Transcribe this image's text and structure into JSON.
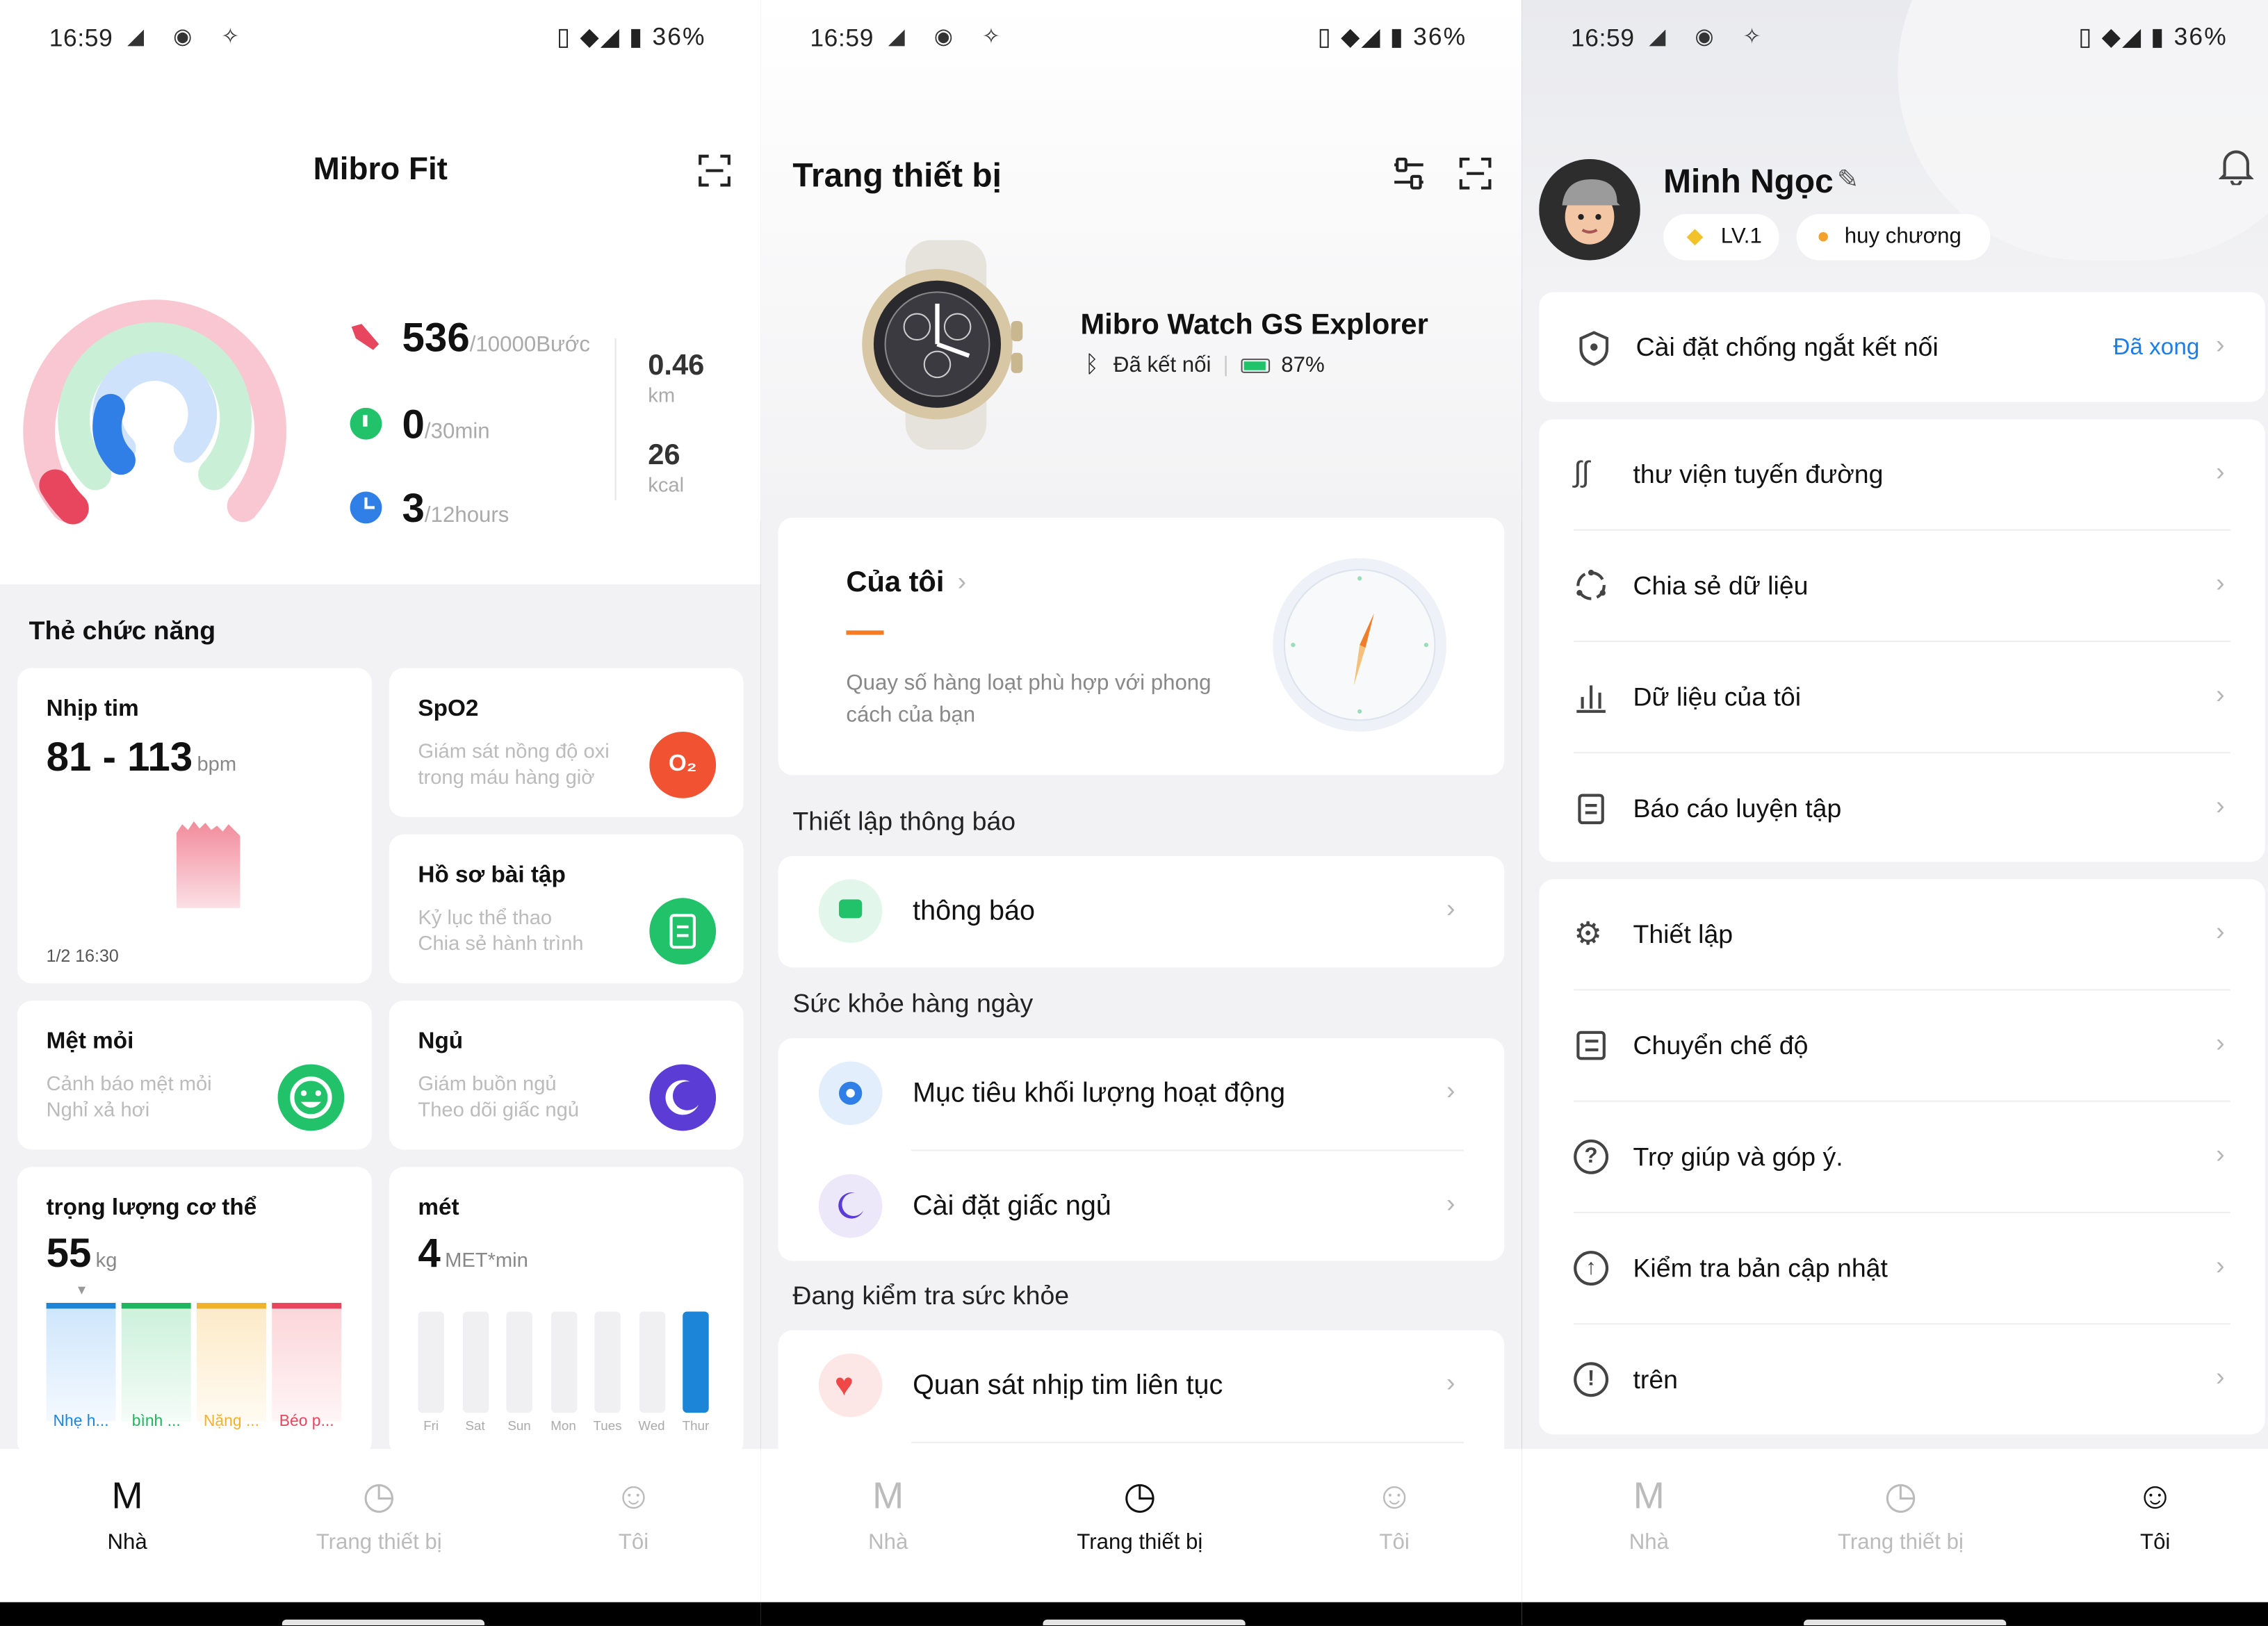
{
  "status_bar": {
    "time": "16:59",
    "battery": "36%",
    "left_icons": "◢ ◉ ✧",
    "right_icons": "▯ ◆◢ ▮"
  },
  "nav": {
    "home": "Nhà",
    "device": "Trang thiết bị",
    "me": "Tôi"
  },
  "colors": {
    "accent": "#1d7de8",
    "heart": "#f04848",
    "green": "#21c26a",
    "purple": "#5b3dd6",
    "orange": "#f07d2a"
  },
  "home": {
    "title": "Mibro Fit",
    "steps": {
      "value": "536",
      "goal": "/10000Bước"
    },
    "active": {
      "value": "0",
      "goal": "/30min"
    },
    "stand": {
      "value": "3",
      "goal": "/12hours"
    },
    "distance": {
      "value": "0.46",
      "unit": "km"
    },
    "calories": {
      "value": "26",
      "unit": "kcal"
    },
    "rings": {
      "steps_fraction": 0.0536,
      "active_fraction": 0.0,
      "stand_fraction": 0.25
    },
    "section_title": "Thẻ chức năng",
    "heart": {
      "title": "Nhịp tim",
      "range": "81 - 113",
      "unit": "bpm",
      "time": "1/2 16:30"
    },
    "spo2": {
      "title": "SpO2",
      "line1": "Giám sát nồng độ oxi",
      "line2": "trong máu hàng giờ",
      "badge": "O₂"
    },
    "workout": {
      "title": "Hồ sơ bài tập",
      "line1": "Kỷ lục thể thao",
      "line2": "Chia sẻ hành trình"
    },
    "fatigue": {
      "title": "Mệt mỏi",
      "line1": "Cảnh báo mệt mỏi",
      "line2": "Nghỉ xả hơi"
    },
    "sleep": {
      "title": "Ngủ",
      "line1": "Giám buồn ngủ",
      "line2": "Theo dõi giấc ngủ"
    },
    "weight": {
      "title": "trọng lượng cơ thể",
      "value": "55",
      "unit": "kg",
      "categories": [
        "Nhẹ h...",
        "bình ...",
        "Nặng ...",
        "Béo p..."
      ]
    },
    "met": {
      "title": "mét",
      "value": "4",
      "unit": "MET*min",
      "days": [
        "Fri",
        "Sat",
        "Sun",
        "Mon",
        "Tues",
        "Wed",
        "Thur"
      ],
      "values": [
        0,
        0,
        0,
        0,
        0,
        0,
        4
      ]
    }
  },
  "device": {
    "title": "Trang thiết bị",
    "watch_name": "Mibro Watch GS Explorer",
    "connection": "Đã kết nối",
    "battery": "87%",
    "mine": {
      "title": "Của tôi",
      "desc1": "Quay số hàng loạt phù hợp với phong",
      "desc2": "cách của bạn"
    },
    "notify_section": "Thiết lập thông báo",
    "notify_item": "thông báo",
    "daily_section": "Sức khỏe hàng ngày",
    "daily_items": [
      "Mục tiêu khối lượng hoạt động",
      "Cài đặt giấc ngủ"
    ],
    "check_section": "Đang kiểm tra sức khỏe",
    "check_item": "Quan sát nhịp tim liên tục"
  },
  "me": {
    "name": "Minh Ngọc",
    "level": "LV.1",
    "medal": "huy chương",
    "anti_disconnect": "Cài đặt chống ngắt kết nối",
    "anti_status": "Đã xong",
    "group1": [
      "thư viện tuyến đường",
      "Chia sẻ dữ liệu",
      "Dữ liệu của tôi",
      "Báo cáo luyện tập"
    ],
    "group2": [
      "Thiết lập",
      "Chuyển chế độ",
      "Trợ giúp và góp ý.",
      "Kiểm tra bản cập nhật",
      "trên"
    ]
  }
}
